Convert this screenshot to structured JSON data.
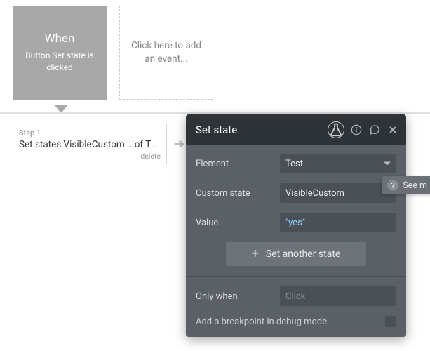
{
  "events": {
    "selected": {
      "title": "When",
      "subtitle": "Button Set state is clicked"
    },
    "add_placeholder": "Click here to add an event..."
  },
  "step": {
    "label": "Step 1",
    "text": "Set states VisibleCustom... of Test",
    "delete": "delete"
  },
  "panel": {
    "title": "Set state",
    "fields": {
      "element": {
        "label": "Element",
        "value": "Test"
      },
      "custom_state": {
        "label": "Custom state",
        "value": "VisibleCustom"
      },
      "value": {
        "label": "Value",
        "value": "\"yes\""
      }
    },
    "add_state_btn": "Set another state",
    "only_when": {
      "label": "Only when",
      "placeholder": "Click"
    },
    "breakpoint": {
      "label": "Add a breakpoint in debug mode"
    }
  },
  "side_tab": {
    "text": "See m"
  }
}
